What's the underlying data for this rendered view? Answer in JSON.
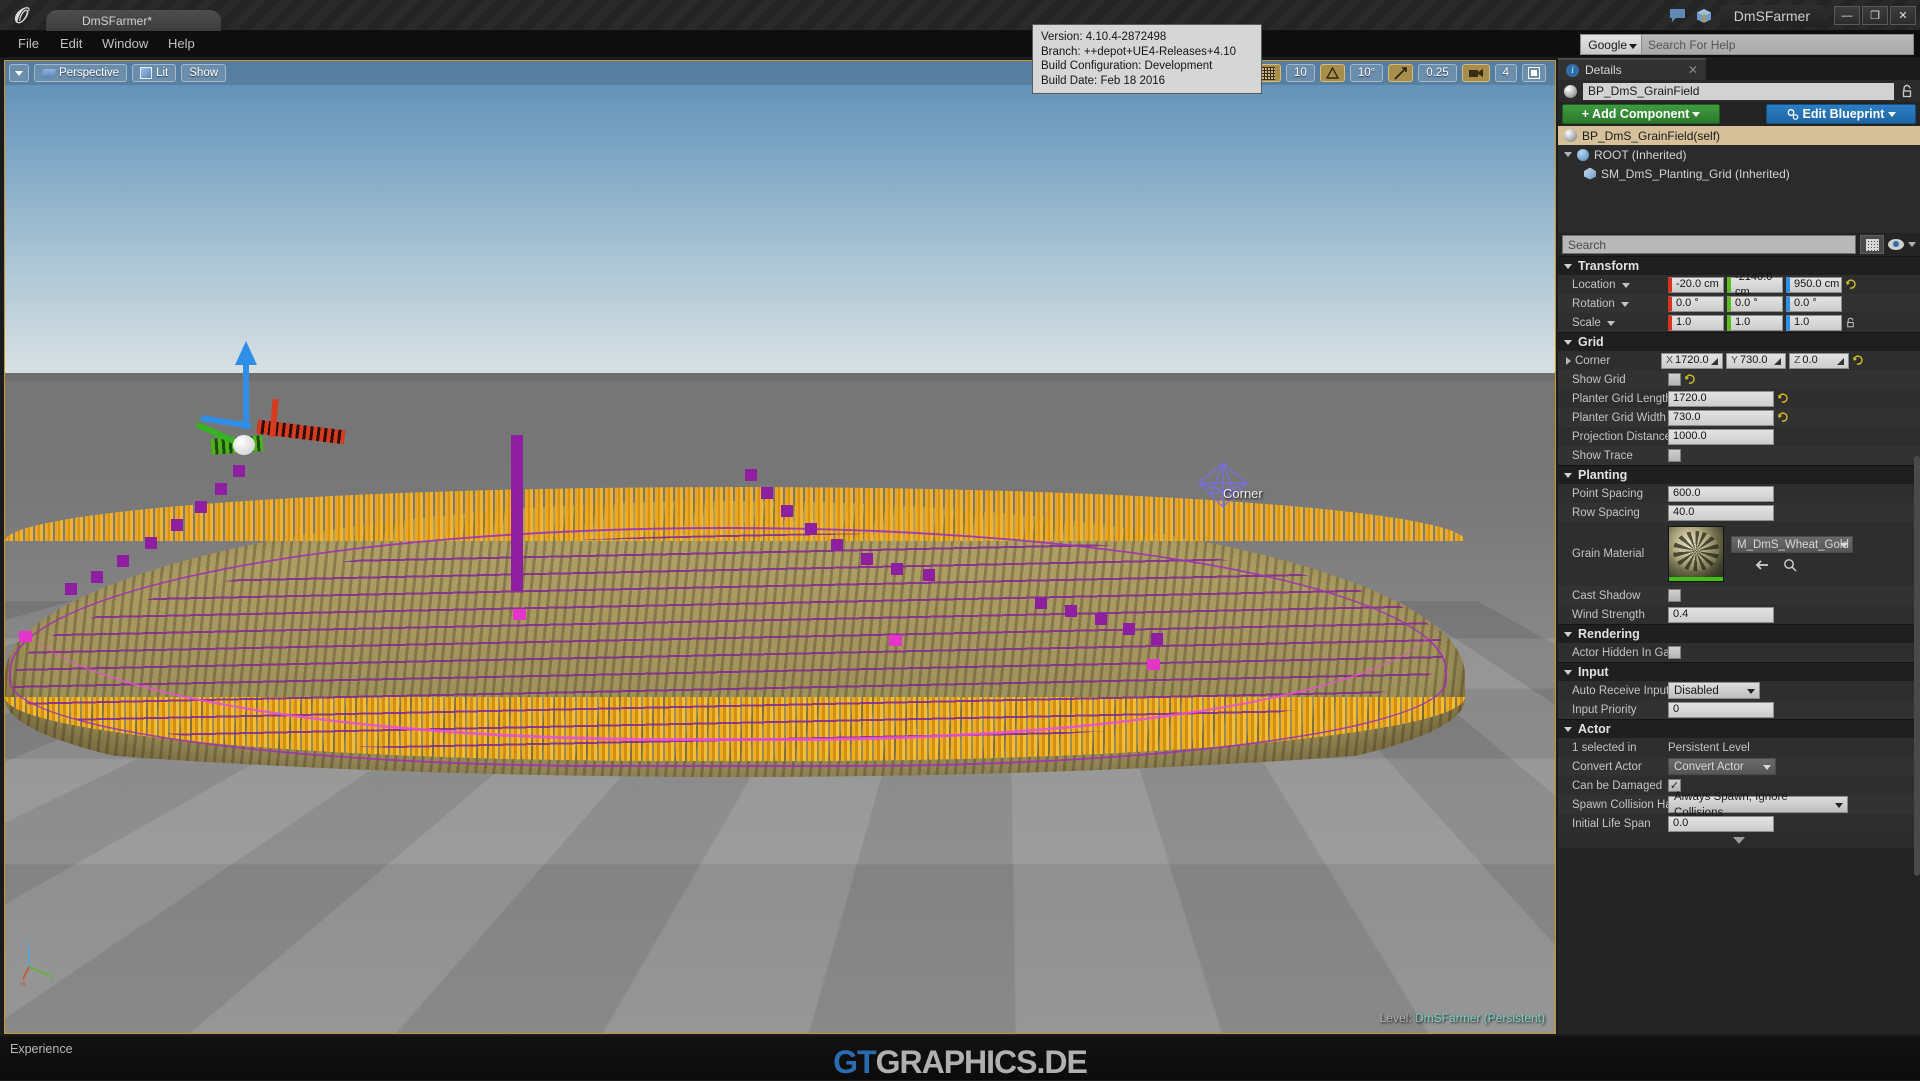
{
  "titlebar": {
    "logo": "unreal-logo",
    "project_tab": "DmSFarmer*",
    "window_title": "DmSFarmer",
    "icons": [
      "feedback-icon",
      "cube-icon"
    ],
    "window_buttons": {
      "minimize": "—",
      "maximize": "❐",
      "close": "✕"
    }
  },
  "menubar": {
    "items": [
      "File",
      "Edit",
      "Window",
      "Help"
    ],
    "help_search": {
      "engine": "Google",
      "placeholder": "Search For Help",
      "value": ""
    }
  },
  "tooltip": {
    "version": "Version: 4.10.4-2872498",
    "branch": "Branch: ++depot+UE4-Releases+4.10",
    "build_configuration": "Build Configuration: Development",
    "build_date": "Build Date: Feb 18 2016"
  },
  "viewport": {
    "toolbar": {
      "view_options": "",
      "perspective": "Perspective",
      "lighting": "Lit",
      "show": "Show",
      "grid_snap_value": "10",
      "angle_snap_value": "10°",
      "scale_snap_value": "0.25",
      "camera_speed_value": "4"
    },
    "corner_billboard_label": "Corner",
    "axis_labels": {
      "z": "z",
      "y": "y",
      "x": "-x"
    },
    "level_prefix": "Level:",
    "level_name": "DmSFarmer (Persistent)"
  },
  "details": {
    "tab_label": "Details",
    "tab_close": "✕",
    "actor_name": "BP_DmS_GrainField",
    "add_component_label": "Add Component",
    "edit_blueprint_label": "Edit Blueprint",
    "tree": [
      {
        "label": "BP_DmS_GrainField(self)",
        "selected": true,
        "indent": 0
      },
      {
        "label": "ROOT (Inherited)",
        "selected": false,
        "indent": 1
      },
      {
        "label": "SM_DmS_Planting_Grid (Inherited)",
        "selected": false,
        "indent": 2
      }
    ],
    "search_placeholder": "Search",
    "search_value": "",
    "sections": {
      "transform": {
        "title": "Transform",
        "location": {
          "label": "Location",
          "x": "-20.0 cm",
          "y": "-2140.0 cm",
          "z": "950.0 cm"
        },
        "rotation": {
          "label": "Rotation",
          "x": "0.0 °",
          "y": "0.0 °",
          "z": "0.0 °"
        },
        "scale": {
          "label": "Scale",
          "x": "1.0",
          "y": "1.0",
          "z": "1.0"
        }
      },
      "grid": {
        "title": "Grid",
        "corner": {
          "label": "Corner",
          "x_label": "X",
          "x": "1720.0",
          "y_label": "Y",
          "y": "730.0",
          "z_label": "Z",
          "z": "0.0"
        },
        "show_grid": {
          "label": "Show Grid",
          "checked": false
        },
        "planter_grid_length": {
          "label": "Planter Grid Length",
          "value": "1720.0"
        },
        "planter_grid_width": {
          "label": "Planter Grid Width",
          "value": "730.0"
        },
        "projection_distance": {
          "label": "Projection Distance",
          "value": "1000.0"
        },
        "show_trace": {
          "label": "Show Trace",
          "checked": false
        }
      },
      "planting": {
        "title": "Planting",
        "point_spacing": {
          "label": "Point Spacing",
          "value": "600.0"
        },
        "row_spacing": {
          "label": "Row Spacing",
          "value": "40.0"
        },
        "grain_material": {
          "label": "Grain Material",
          "value": "M_DmS_Wheat_Gold"
        },
        "cast_shadow": {
          "label": "Cast Shadow",
          "checked": false
        },
        "wind_strength": {
          "label": "Wind Strength",
          "value": "0.4"
        }
      },
      "rendering": {
        "title": "Rendering",
        "actor_hidden_in_game": {
          "label": "Actor Hidden In Gam",
          "checked": false
        }
      },
      "input": {
        "title": "Input",
        "auto_receive_input": {
          "label": "Auto Receive Input",
          "value": "Disabled"
        },
        "input_priority": {
          "label": "Input Priority",
          "value": "0"
        }
      },
      "actor": {
        "title": "Actor",
        "selected_in": {
          "label": "1 selected in",
          "value": "Persistent Level"
        },
        "convert_actor": {
          "label": "Convert Actor",
          "value": "Convert Actor"
        },
        "can_be_damaged": {
          "label": "Can be Damaged",
          "checked": true
        },
        "spawn_collision": {
          "label": "Spawn Collision Han",
          "value": "Always Spawn, Ignore Collisions"
        },
        "initial_life_span": {
          "label": "Initial Life Span",
          "value": "0.0"
        }
      }
    }
  },
  "statusbar": {
    "experience": "Experience",
    "watermark_accent": "GT",
    "watermark_rest": "GRAPHICS.DE"
  },
  "colors": {
    "accent_orange": "#c8962e",
    "add_green": "#3f9c3f",
    "edit_blue": "#2a7fc4",
    "axis_x": "#d4331e",
    "axis_y": "#5bbd20",
    "axis_z": "#2f8fe8",
    "debug_purple": "#8e1fa0",
    "wheat_gold": "#f0a81b"
  }
}
